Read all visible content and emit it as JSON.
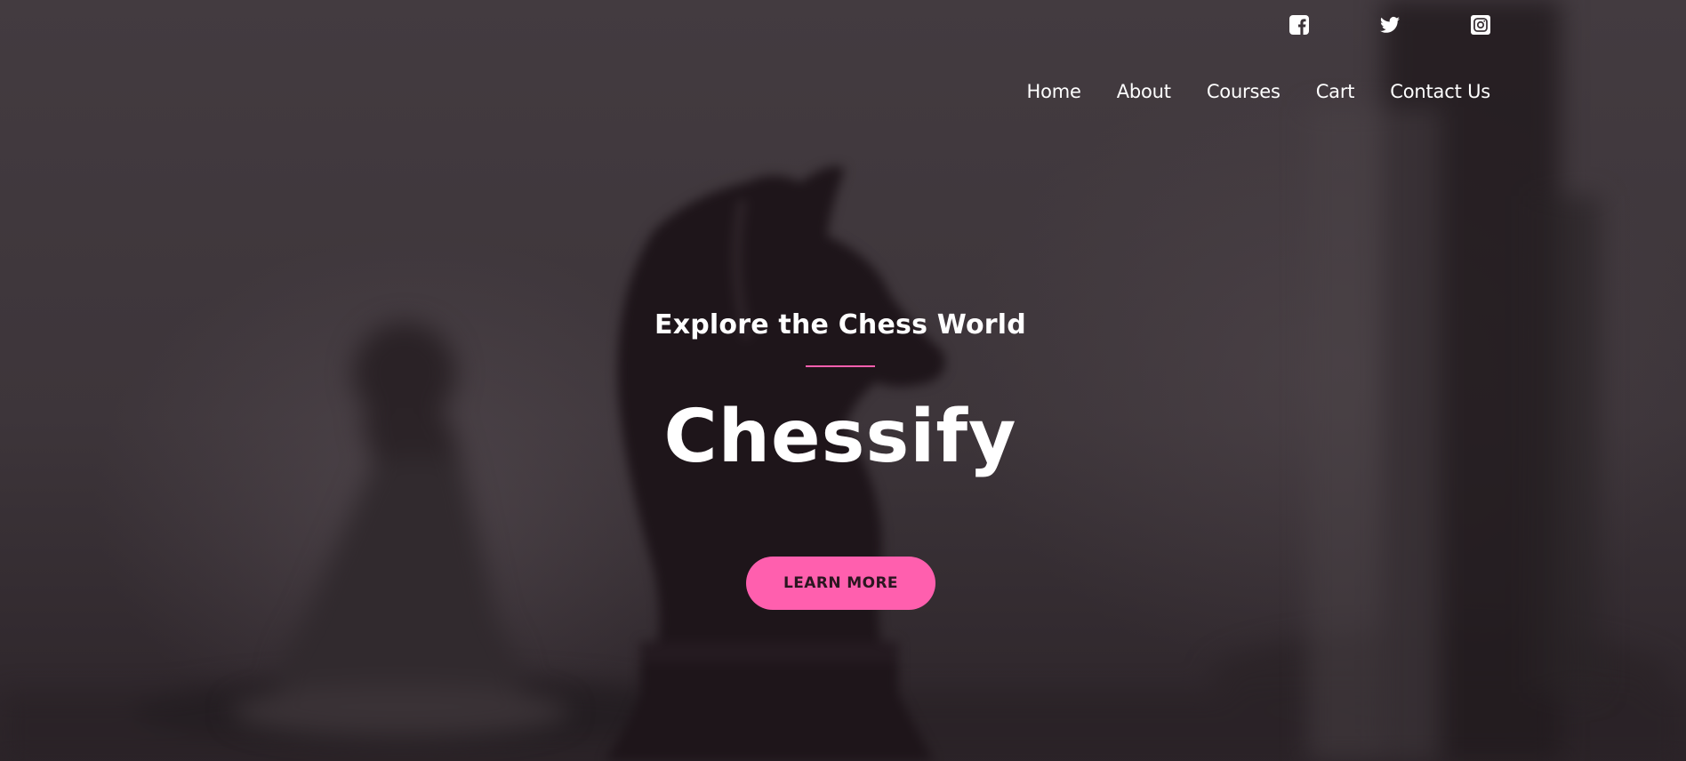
{
  "social": {
    "icons": [
      {
        "name": "facebook-icon"
      },
      {
        "name": "twitter-icon"
      },
      {
        "name": "instagram-icon"
      }
    ]
  },
  "nav": {
    "items": [
      {
        "label": "Home"
      },
      {
        "label": "About"
      },
      {
        "label": "Courses"
      },
      {
        "label": "Cart"
      },
      {
        "label": "Contact Us"
      }
    ]
  },
  "hero": {
    "eyebrow": "Explore the Chess World",
    "title": "Chessify",
    "cta_label": "LEARN MORE"
  },
  "colors": {
    "accent": "#ff5fae",
    "background": "#3b3338",
    "text": "#ffffff"
  }
}
